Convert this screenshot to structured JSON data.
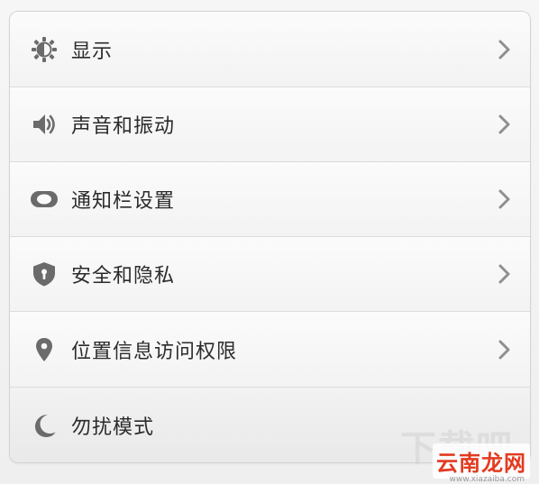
{
  "settings": {
    "items": [
      {
        "label": "显示",
        "icon": "brightness-icon",
        "has_chevron": true
      },
      {
        "label": "声音和振动",
        "icon": "speaker-icon",
        "has_chevron": true
      },
      {
        "label": "通知栏设置",
        "icon": "toggle-icon",
        "has_chevron": true
      },
      {
        "label": "安全和隐私",
        "icon": "shield-lock-icon",
        "has_chevron": true
      },
      {
        "label": "位置信息访问权限",
        "icon": "location-pin-icon",
        "has_chevron": true
      },
      {
        "label": "勿扰模式",
        "icon": "moon-icon",
        "has_chevron": false
      }
    ]
  },
  "watermark": {
    "site_name": "云南龙网",
    "ghost_text": "下载吧",
    "url": "www.xiazaiba.com"
  },
  "colors": {
    "icon": "#6b6b6b",
    "chevron": "#8f8f8f",
    "text": "#2b2b2b",
    "watermark_red": "#e23b20"
  }
}
